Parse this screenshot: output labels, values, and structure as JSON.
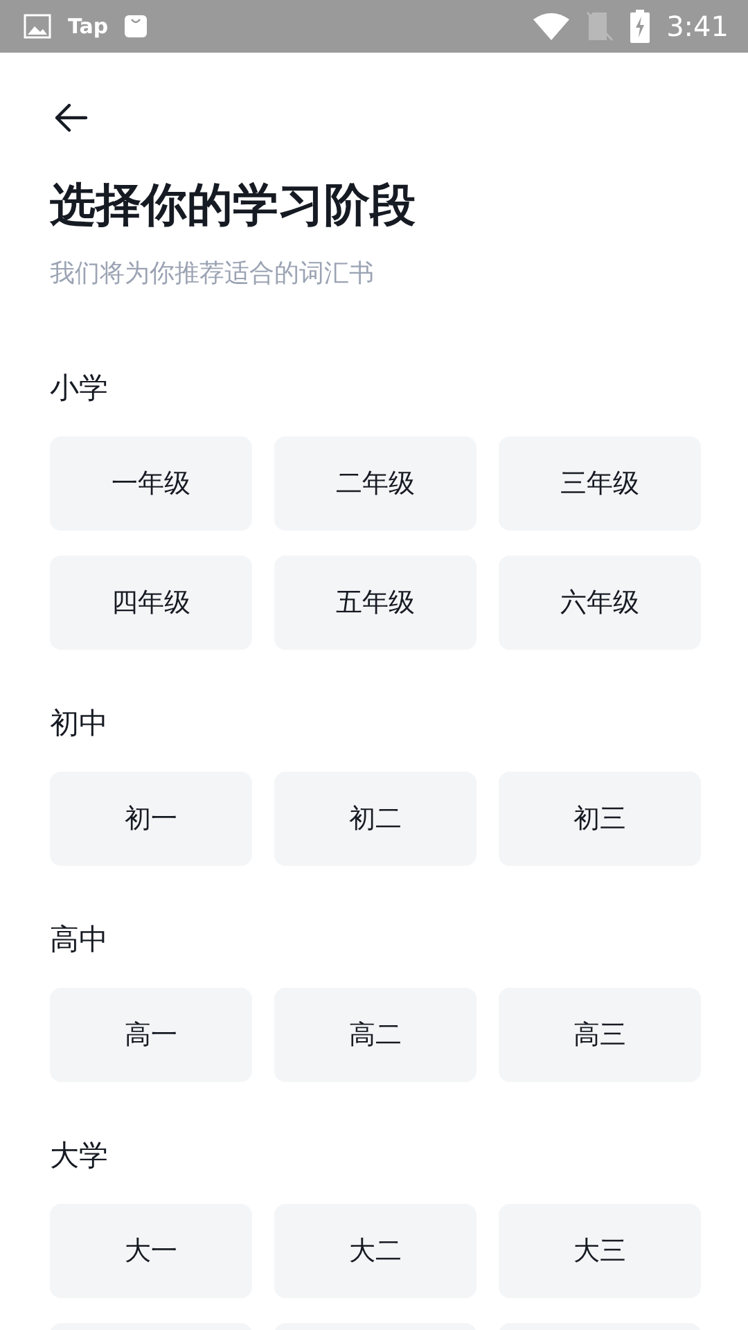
{
  "status_bar": {
    "apps": [
      "Tap"
    ],
    "time": "3:41"
  },
  "title": "选择你的学习阶段",
  "subtitle": "我们将为你推荐适合的词汇书",
  "sections": [
    {
      "label": "小学",
      "options": [
        {
          "kind": "option",
          "label": "一年级"
        },
        {
          "kind": "option",
          "label": "二年级"
        },
        {
          "kind": "option",
          "label": "三年级"
        },
        {
          "kind": "option",
          "label": "四年级"
        },
        {
          "kind": "option",
          "label": "五年级"
        },
        {
          "kind": "option",
          "label": "六年级"
        }
      ]
    },
    {
      "label": "初中",
      "options": [
        {
          "kind": "option",
          "label": "初一"
        },
        {
          "kind": "option",
          "label": "初二"
        },
        {
          "kind": "option",
          "label": "初三"
        }
      ]
    },
    {
      "label": "高中",
      "options": [
        {
          "kind": "option",
          "label": "高一"
        },
        {
          "kind": "option",
          "label": "高二"
        },
        {
          "kind": "option",
          "label": "高三"
        }
      ]
    },
    {
      "label": "大学",
      "options": [
        {
          "kind": "option",
          "label": "大一"
        },
        {
          "kind": "option",
          "label": "大二"
        },
        {
          "kind": "option",
          "label": "大三"
        },
        {
          "kind": "cut"
        },
        {
          "kind": "cut"
        },
        {
          "kind": "cut"
        }
      ]
    }
  ]
}
